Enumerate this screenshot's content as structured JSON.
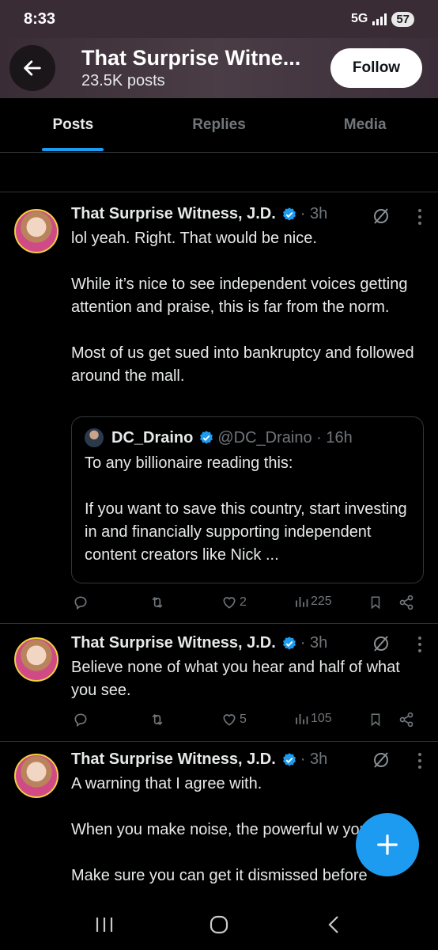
{
  "status_bar": {
    "time": "8:33",
    "network": "5G",
    "battery": "57"
  },
  "header": {
    "title": "That Surprise Witne...",
    "subtitle": "23.5K posts",
    "follow_label": "Follow"
  },
  "tabs": [
    {
      "label": "Posts",
      "active": true
    },
    {
      "label": "Replies",
      "active": false
    },
    {
      "label": "Media",
      "active": false
    }
  ],
  "posts": [
    {
      "author": "That Surprise Witness, J.D.",
      "time": "· 3h",
      "paragraphs": [
        "lol yeah. Right. That would be nice.",
        "While it’s nice to see independent voices getting attention and praise, this is far from the norm.",
        "Most of us get sued into bankruptcy and followed around the mall."
      ],
      "quote": {
        "name": "DC_Draino",
        "handle": "@DC_Draino · 16h",
        "paragraphs": [
          "To any billionaire reading this:",
          "If you want to save this country, start investing in and financially supporting independent content creators like Nick ..."
        ]
      },
      "likes": "2",
      "views": "225"
    },
    {
      "author": "That Surprise Witness, J.D.",
      "time": "· 3h",
      "paragraphs": [
        "Believe none of what you hear and half of what you see."
      ],
      "likes": "5",
      "views": "105"
    },
    {
      "author": "That Surprise Witness, J.D.",
      "time": "· 3h",
      "paragraphs": [
        "A warning that I agree with.",
        "When you make noise, the powerful w you.",
        "Make sure you can get it dismissed before"
      ]
    }
  ],
  "colors": {
    "accent": "#1d9bf0",
    "background": "#000000",
    "muted": "#71767b",
    "text": "#e7e9ea"
  },
  "icons": {
    "back": "arrow-left-icon",
    "verified": "verified-badge-icon",
    "grok": "grok-icon",
    "more": "more-vertical-icon",
    "reply": "reply-icon",
    "repost": "repost-icon",
    "like": "heart-icon",
    "views": "views-icon",
    "bookmark": "bookmark-icon",
    "share": "share-icon",
    "compose": "plus-icon"
  }
}
